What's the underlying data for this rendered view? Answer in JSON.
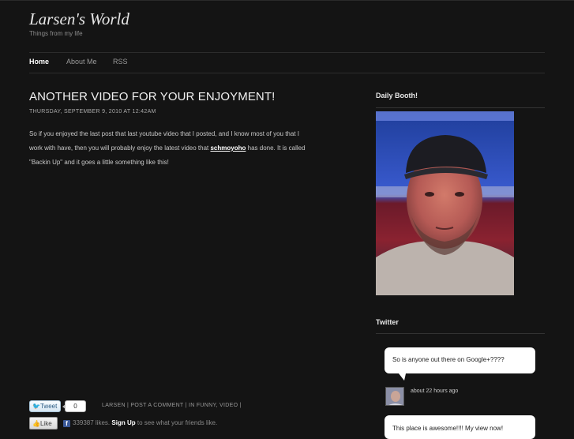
{
  "site": {
    "title": "Larsen's World",
    "tagline": "Things from my life"
  },
  "nav": {
    "items": [
      {
        "label": "Home",
        "active": true
      },
      {
        "label": "About Me",
        "active": false
      },
      {
        "label": "RSS",
        "active": false
      }
    ]
  },
  "post": {
    "title": "ANOTHER VIDEO FOR YOUR ENJOYMENT!",
    "date": "THURSDAY, SEPTEMBER 9, 2010 AT 12:42AM",
    "body_line1": "So if you enjoyed the last post that last youtube video that I posted, and I know most of you that I",
    "body_line2_a": "work with have, then you will probably enjoy the latest video that",
    "body_link": "schmoyoho",
    "body_line2_b": "has done.  It is called",
    "body_line3": "\"Backin Up\" and it goes a little something like this!",
    "tweet_label": "Tweet",
    "tweet_count": "0",
    "meta": {
      "author": "LARSEN",
      "comment": "POST A COMMENT",
      "in_label": "IN",
      "categories": "FUNNY, VIDEO"
    },
    "like_label": "Like",
    "likes_text": "339387 likes.",
    "signup_label": "Sign Up",
    "signup_suffix": "to see what your friends like."
  },
  "sidebar": {
    "daily_booth_title": "Daily Booth!",
    "twitter_title": "Twitter",
    "tweets": [
      {
        "text": "So is anyone out there on Google+????",
        "time": "about 22 hours ago"
      },
      {
        "text": "This place is awesome!!!! My view now!"
      }
    ]
  },
  "colors": {
    "background": "#141414",
    "text": "#cccccc",
    "heading": "#f2f2f2",
    "facebook": "#3b5998",
    "twitter": "#41a1da"
  }
}
